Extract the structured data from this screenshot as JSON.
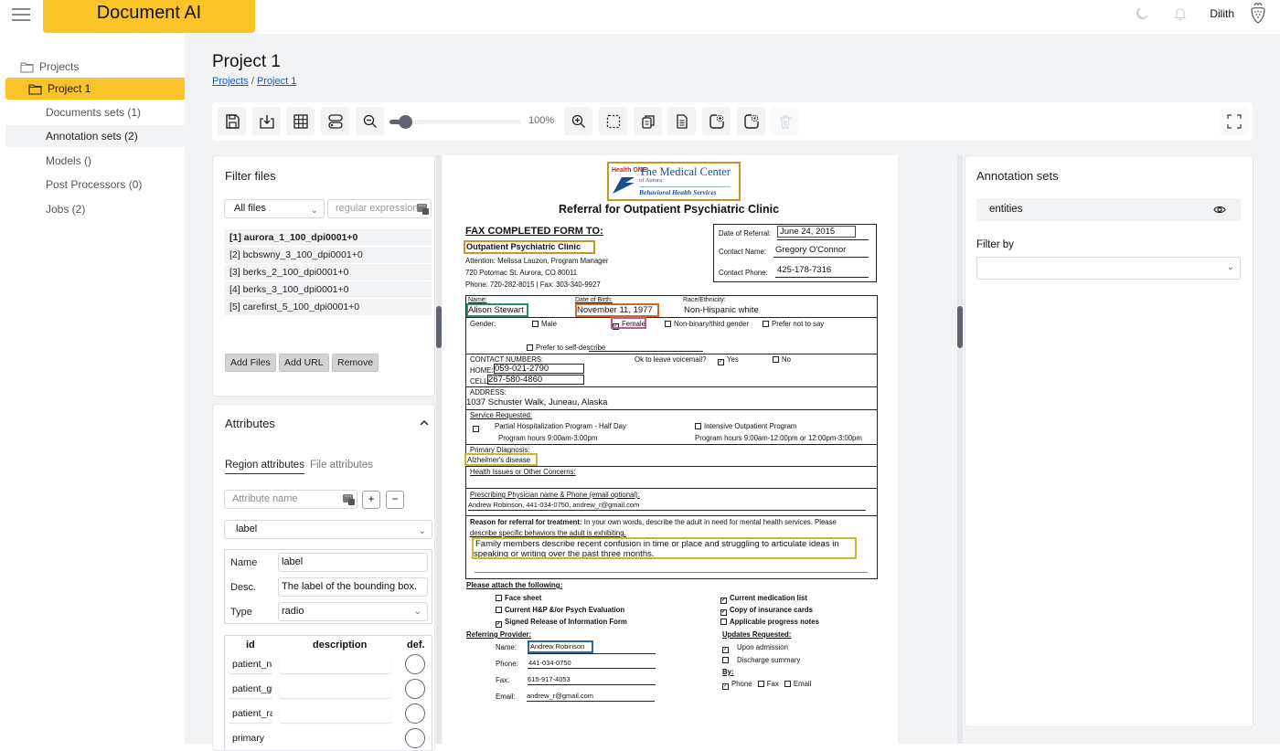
{
  "header": {
    "brand": "Document AI",
    "username": "Dilith",
    "icons": [
      "menu-icon",
      "moon-icon",
      "bell-icon",
      "strawberry-avatar-icon"
    ]
  },
  "sidebar": {
    "items": [
      {
        "label": "Projects",
        "icon": "folder-icon"
      },
      {
        "label": "Project 1",
        "icon": "folder-icon",
        "active": true
      },
      {
        "label": "Documents sets (1)"
      },
      {
        "label": "Annotation sets (2)",
        "hover": true
      },
      {
        "label": "Models ()"
      },
      {
        "label": "Post Processors (0)"
      },
      {
        "label": "Jobs (2)"
      }
    ]
  },
  "page": {
    "title": "Project 1",
    "breadcrumb": [
      {
        "label": "Projects"
      },
      {
        "label": "Project 1"
      }
    ],
    "breadcrumb_sep": "/"
  },
  "toolbar": {
    "buttons": [
      "save-icon",
      "download-icon",
      "grid-icon",
      "toggle-layout-icon",
      "zoom-out-icon",
      "zoom-in-icon",
      "select-region-icon",
      "copy-icon",
      "document-icon",
      "add-region-icon",
      "remove-region-icon",
      "delete-icon",
      "fullscreen-icon"
    ],
    "zoom_value": 0.1,
    "zoom_label": "100%"
  },
  "filter_files": {
    "title": "Filter files",
    "select_value": "All files",
    "regex_placeholder": "regular expression",
    "files": [
      "[1] aurora_1_100_dpi0001+0",
      "[2] bcbswny_3_100_dpi0001+0",
      "[3] berks_2_100_dpi0001+0",
      "[4] berks_3_100_dpi0001+0",
      "[5] carefirst_5_100_dpi0001+0"
    ],
    "buttons": {
      "add_files": "Add Files",
      "add_url": "Add URL",
      "remove": "Remove"
    }
  },
  "attributes": {
    "title": "Attributes",
    "tabs": [
      "Region attributes",
      "File attributes"
    ],
    "name_placeholder": "Attribute name",
    "plus": "+",
    "minus": "−",
    "selected_attribute": "label",
    "name_label": "Name",
    "name_value": "label",
    "desc_label": "Desc.",
    "desc_value": "The label of the bounding box.",
    "type_label": "Type",
    "type_value": "radio",
    "options_headers": [
      "id",
      "description",
      "def."
    ],
    "options": [
      "patient_name",
      "patient_gender",
      "patient_race",
      "primary"
    ]
  },
  "document": {
    "logo": {
      "line1": "Health ONE",
      "line2": "The Medical Center",
      "line3": "of Aurora",
      "line4": "Behavioral Health Services"
    },
    "title": "Referral for Outpatient Psychiatric Clinic",
    "fax_heading": "FAX COMPLETED FORM TO:",
    "clinic": "Outpatient Psychiatric Clinic",
    "attention": "Attention: Melissa Lauzon, Program Manager",
    "address": "720 Potomac St. Aurora, CO 80011",
    "phone_fax": "Phone: 720-282-8015 | Fax: 303-340-9927",
    "date_of_referral_label": "Date of Referral:",
    "date_of_referral": "June 24, 2015",
    "contact_name_label": "Contact Name:",
    "contact_name": "Gregory O'Connor",
    "contact_phone_label": "Contact Phone:",
    "contact_phone": "425-178-7316",
    "name_label": "Name:",
    "name": "Alison Stewart",
    "dob_label": "Date of Birth:",
    "dob": "November 11, 1977",
    "race_label": "Race/Ethnicity:",
    "race": "Non-Hispanic white",
    "gender_label": "Gender:",
    "gender_options": [
      "Male",
      "Female",
      "Non-binary/third gender",
      "Prefer not to say",
      "Prefer to self-describe"
    ],
    "contact_numbers_label": "CONTACT NUMBERS:",
    "voicemail_label": "Ok to leave voicemail?",
    "voicemail_yes": "Yes",
    "voicemail_no": "No",
    "home_label": "HOME:",
    "home": "059-021-2790",
    "cell_label": "CELL:",
    "cell": "267-580-4860",
    "address_label": "ADDRESS:",
    "patient_address": "1037 Schuster Walk, Juneau, Alaska",
    "service_label": "Service Requested:",
    "service1": "Partial Hospitalization Program - Half Day",
    "service1_hours": "Program hours 9:00am-3:00pm",
    "service2": "Intensive Outpatient Program",
    "service2_hours": "Program hours 9:00am-12:00pm or 12:00pm-3:00pm",
    "diagnosis_label": "Primary Diagnosis:",
    "diagnosis": "Alzheimer's disease",
    "health_issues_label": "Health Issues or Other Concerns:",
    "physician_label": "Prescribing Physician name & Phone (email optional):",
    "physician": "Andrew Robinson, 441-034-0750, andrew_r@gmail.com",
    "reason_label": "Reason for referral for treatment:",
    "reason_prompt": " In your own words, describe the adult in need for mental health services. Please",
    "reason_prompt2": "describe specific behaviors the adult is exhibiting.",
    "reason_line1": "Family members describe recent confusion in time or place and struggling to articulate ideas in",
    "reason_line2": "speaking or writing over the past three months.",
    "attach_label": "Please attach the following:",
    "attach_left": [
      "Face sheet",
      "Current H&P &/or Psych Evaluation",
      "Signed Release of Information Form"
    ],
    "attach_right": [
      "Current medication list",
      "Copy of insurance cards",
      "Applicable progress notes"
    ],
    "referring_label": "Referring Provider:",
    "ref_name_label": "Name:",
    "ref_name": "Andrew Robinson",
    "ref_phone_label": "Phone:",
    "ref_phone": "441-034-0750",
    "ref_fax_label": "Fax:",
    "ref_fax": "615-917-4053",
    "ref_email_label": "Email:",
    "ref_email": "andrew_r@gmail.com",
    "updates_label": "Updates Requested:",
    "updates": [
      "Upon admission",
      "Discharge summary"
    ],
    "by_label": "By:",
    "by_options": [
      "Phone",
      "Fax",
      "Email"
    ],
    "annotation_colors": {
      "logo": "#c8962a",
      "clinic": "#c8962a",
      "date": "#444444",
      "name": "#2e8b6e",
      "dob": "#d2691e",
      "gender": "#b0609b",
      "diagnosis": "#c9b82a",
      "reason": "#c9b82a",
      "referrer": "#2a6aa0"
    }
  },
  "annotation_sets": {
    "title": "Annotation sets",
    "items": [
      {
        "label": "entities"
      }
    ],
    "filter_label": "Filter by",
    "filter_value": ""
  },
  "colors": {
    "accent": "#fbc52a",
    "background": "#f2f3f5",
    "link": "#1a56c8"
  }
}
